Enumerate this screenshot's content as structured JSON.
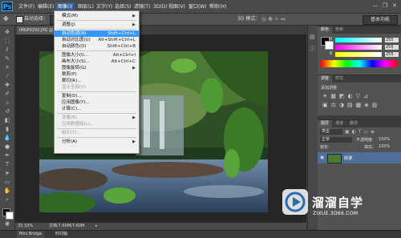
{
  "app": {
    "logo": "Ps"
  },
  "menubar": {
    "items": [
      "文件(F)",
      "编辑(E)",
      "图像(I)",
      "图层(L)",
      "文字(Y)",
      "选择(S)",
      "滤镜(T)",
      "3D(D)",
      "视图(V)",
      "窗口(W)",
      "帮助(H)"
    ]
  },
  "window_controls": {
    "minimize": "—",
    "restore": "❐",
    "close": "✕"
  },
  "options_bar": {
    "auto_select_label": "自动选择：",
    "mode_3d_label": "3D 模式：",
    "workspace": "基本功能"
  },
  "document": {
    "tab_title": "IMGP0292.JPG @ 33.3%",
    "close_glyph": "×"
  },
  "status": {
    "zoom": "33.33%",
    "doc_info": "文档:7.60M/7.60M"
  },
  "bottom_bar": {
    "mini_bridge": "Mini Bridge",
    "timeline": "时间轴"
  },
  "dropdown": {
    "items": [
      {
        "label": "模式(M)",
        "shortcut": "",
        "submenu": true,
        "disabled": false,
        "highlight": false
      },
      {
        "sep": true
      },
      {
        "label": "调整(J)",
        "shortcut": "",
        "submenu": true,
        "disabled": false,
        "highlight": false
      },
      {
        "sep": true
      },
      {
        "label": "自动色调(N)",
        "shortcut": "Shift+Ctrl+L",
        "submenu": false,
        "disabled": false,
        "highlight": true
      },
      {
        "label": "自动对比度(U)",
        "shortcut": "Alt+Shift+Ctrl+L",
        "submenu": false,
        "disabled": false,
        "highlight": false
      },
      {
        "label": "自动颜色(O)",
        "shortcut": "Shift+Ctrl+B",
        "submenu": false,
        "disabled": false,
        "highlight": false
      },
      {
        "sep": true
      },
      {
        "label": "图像大小(I)...",
        "shortcut": "Alt+Ctrl+I",
        "submenu": false,
        "disabled": false,
        "highlight": false
      },
      {
        "label": "画布大小(S)...",
        "shortcut": "Alt+Ctrl+C",
        "submenu": false,
        "disabled": false,
        "highlight": false
      },
      {
        "label": "图像旋转(G)",
        "shortcut": "",
        "submenu": true,
        "disabled": false,
        "highlight": false
      },
      {
        "label": "裁剪(P)",
        "shortcut": "",
        "submenu": false,
        "disabled": false,
        "highlight": false
      },
      {
        "label": "裁切(R)...",
        "shortcut": "",
        "submenu": false,
        "disabled": false,
        "highlight": false
      },
      {
        "label": "显示全部(V)",
        "shortcut": "",
        "submenu": false,
        "disabled": true,
        "highlight": false
      },
      {
        "sep": true
      },
      {
        "label": "复制(D)...",
        "shortcut": "",
        "submenu": false,
        "disabled": false,
        "highlight": false
      },
      {
        "label": "应用图像(Y)...",
        "shortcut": "",
        "submenu": false,
        "disabled": false,
        "highlight": false
      },
      {
        "label": "计算(C)...",
        "shortcut": "",
        "submenu": false,
        "disabled": false,
        "highlight": false
      },
      {
        "sep": true
      },
      {
        "label": "变量(B)",
        "shortcut": "",
        "submenu": true,
        "disabled": true,
        "highlight": false
      },
      {
        "label": "应用数据组(L)...",
        "shortcut": "",
        "submenu": false,
        "disabled": true,
        "highlight": false
      },
      {
        "sep": true
      },
      {
        "label": "陷印(T)...",
        "shortcut": "",
        "submenu": false,
        "disabled": true,
        "highlight": false
      },
      {
        "sep": true
      },
      {
        "label": "分析(A)",
        "shortcut": "",
        "submenu": true,
        "disabled": false,
        "highlight": false
      }
    ]
  },
  "color_panel": {
    "tabs": [
      "颜色",
      "色板"
    ],
    "channels": [
      {
        "name": "R",
        "value": "255"
      },
      {
        "name": "G",
        "value": "255"
      },
      {
        "name": "B",
        "value": "255"
      }
    ]
  },
  "adjust_panel": {
    "tabs": [
      "调整",
      "样式"
    ],
    "add_label": "添加调整"
  },
  "layers_panel": {
    "tabs": [
      "图层",
      "通道",
      "路径"
    ],
    "kind_label": "类型",
    "blend_mode": "正常",
    "opacity_label": "不透明度:",
    "opacity_value": "100%",
    "lock_label": "锁定:",
    "fill_label": "填充:",
    "fill_value": "100%",
    "layer_name": "背景"
  },
  "watermark": {
    "title": "溜溜自学",
    "subtitle": "ZIXUE.3D66.COM"
  },
  "colors": {
    "highlight": "#3399ff",
    "menu_bg": "#f0f0f0",
    "ui_dark": "#535353"
  }
}
